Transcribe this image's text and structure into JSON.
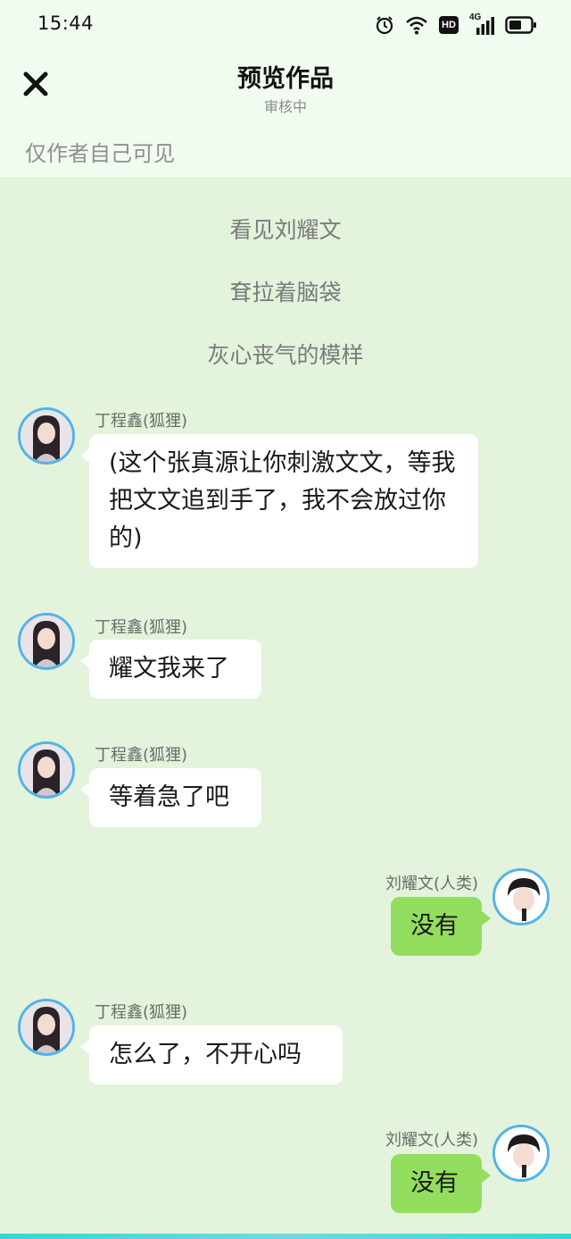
{
  "status_bar": {
    "time": "15:44",
    "icons": [
      "alarm-icon",
      "wifi-icon",
      "hd-icon",
      "signal-4g-icon",
      "battery-icon"
    ],
    "network_label": "4G",
    "hd_label": "HD"
  },
  "header": {
    "close_icon": "close-icon",
    "title": "预览作品",
    "subtitle": "审核中",
    "visibility_note": "仅作者自己可见"
  },
  "narration": [
    "看见刘耀文",
    "耷拉着脑袋",
    "灰心丧气的模样"
  ],
  "messages": [
    {
      "side": "left",
      "sender": "丁程鑫(狐狸)",
      "text": "(这个张真源让你刺激文文，等我把文文追到手了，我不会放过你的)"
    },
    {
      "side": "left",
      "sender": "丁程鑫(狐狸)",
      "text": "耀文我来了"
    },
    {
      "side": "left",
      "sender": "丁程鑫(狐狸)",
      "text": "等着急了吧"
    },
    {
      "side": "right",
      "sender": "刘耀文(人类)",
      "text": "没有"
    },
    {
      "side": "left",
      "sender": "丁程鑫(狐狸)",
      "text": "怎么了，不开心吗"
    },
    {
      "side": "right",
      "sender": "刘耀文(人类)",
      "text": "没有"
    }
  ],
  "colors": {
    "chat_background": "#e3f3dc",
    "header_background": "#f1fcf0",
    "right_bubble": "#93dd5f",
    "left_bubble": "#ffffff",
    "avatar_ring": "#52b4e6"
  }
}
